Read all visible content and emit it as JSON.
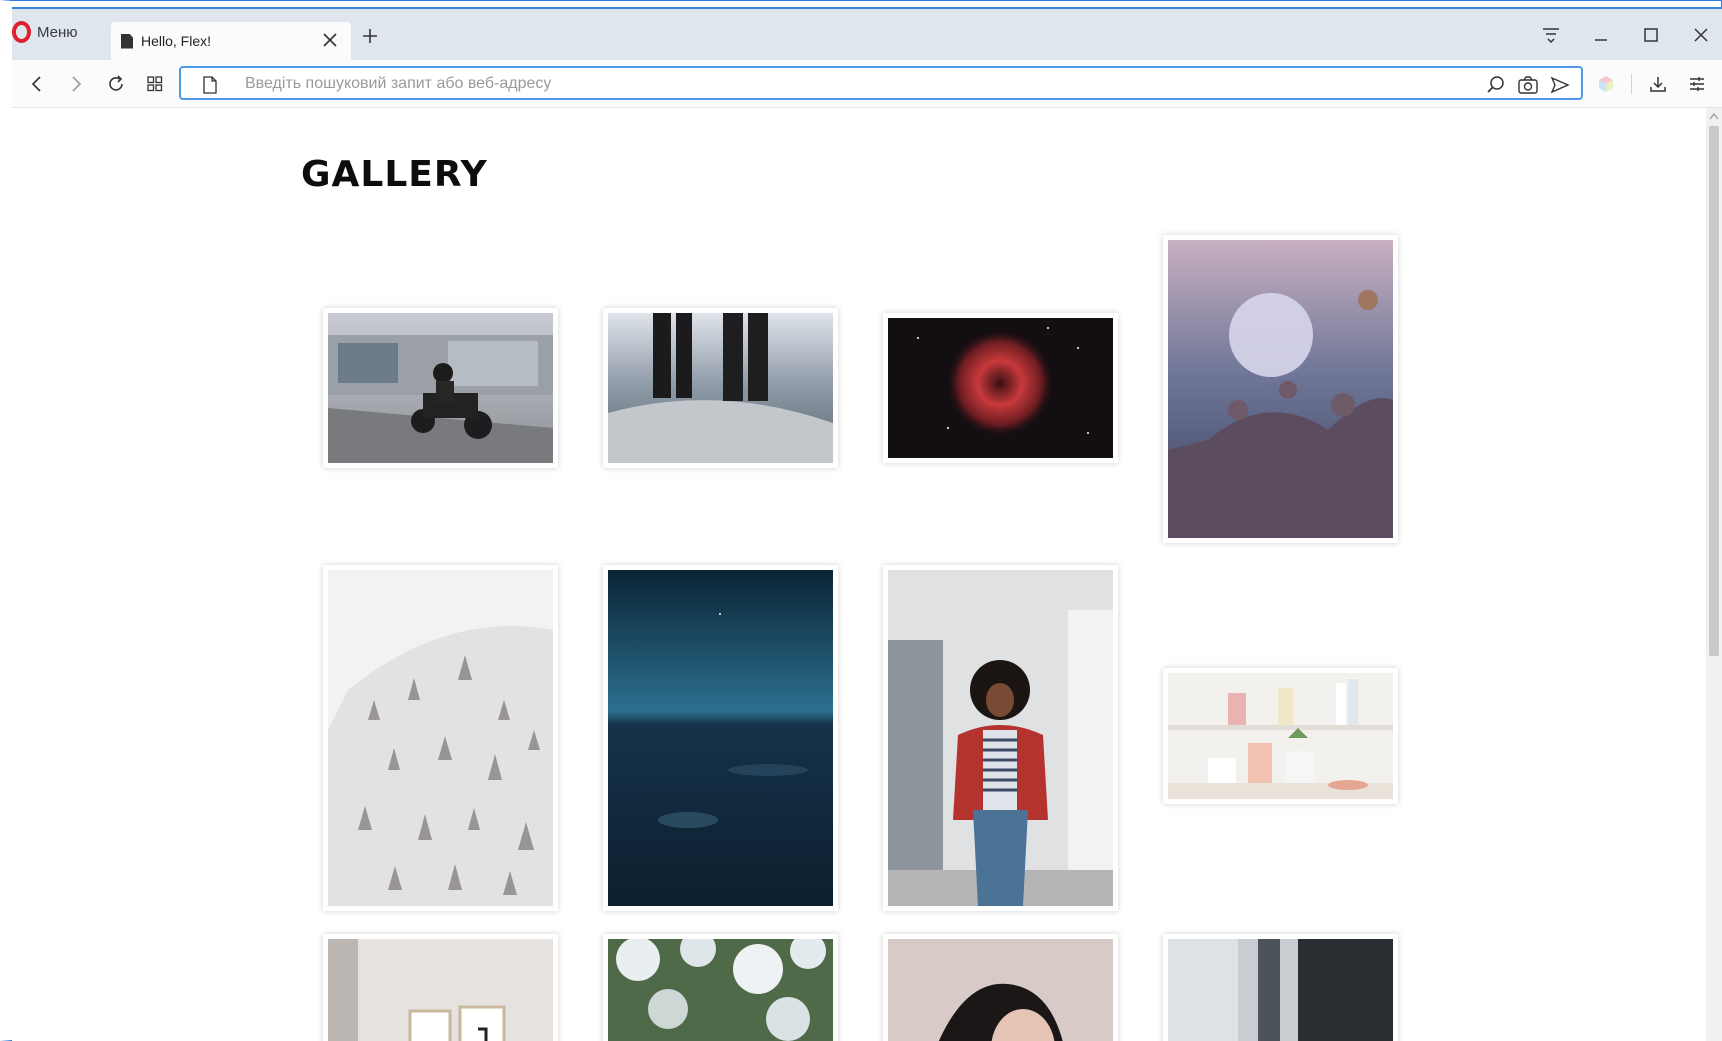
{
  "browser": {
    "menu_label": "Меню",
    "tab_title": "Hello, Flex!",
    "address_placeholder": "Введіть пошуковий запит або веб-адресу",
    "address_value": ""
  },
  "page": {
    "heading": "GALLERY",
    "photos": [
      {
        "name": "motorcycle-photo",
        "subject": "motorcyclist riding past graffiti wall"
      },
      {
        "name": "legs-on-rock-photo",
        "subject": "two people standing on snowy rock by the sea"
      },
      {
        "name": "nebula-photo",
        "subject": "red rosette nebula in starry sky"
      },
      {
        "name": "frozen-bubble-photo",
        "subject": "frozen soap bubble on a plant at dusk"
      },
      {
        "name": "snowy-forest-photo",
        "subject": "snow covered forest slope"
      },
      {
        "name": "night-sky-photo",
        "subject": "aerial view of landscape under night sky"
      },
      {
        "name": "woman-portrait-photo",
        "subject": "woman in red jacket and striped shirt"
      },
      {
        "name": "shelf-plants-photo",
        "subject": "shelf with plants and cosmetics"
      },
      {
        "name": "room-frames-photo",
        "subject": "room with framed pictures"
      },
      {
        "name": "flowers-photo",
        "subject": "white flowers close-up"
      },
      {
        "name": "woman-hair-photo",
        "subject": "woman with dark hair"
      },
      {
        "name": "window-photo",
        "subject": "window with dark frame"
      }
    ]
  },
  "colors": {
    "accent": "#4d9be6",
    "opera_red": "#e01e2d",
    "tabbar": "#dfe6ee"
  }
}
